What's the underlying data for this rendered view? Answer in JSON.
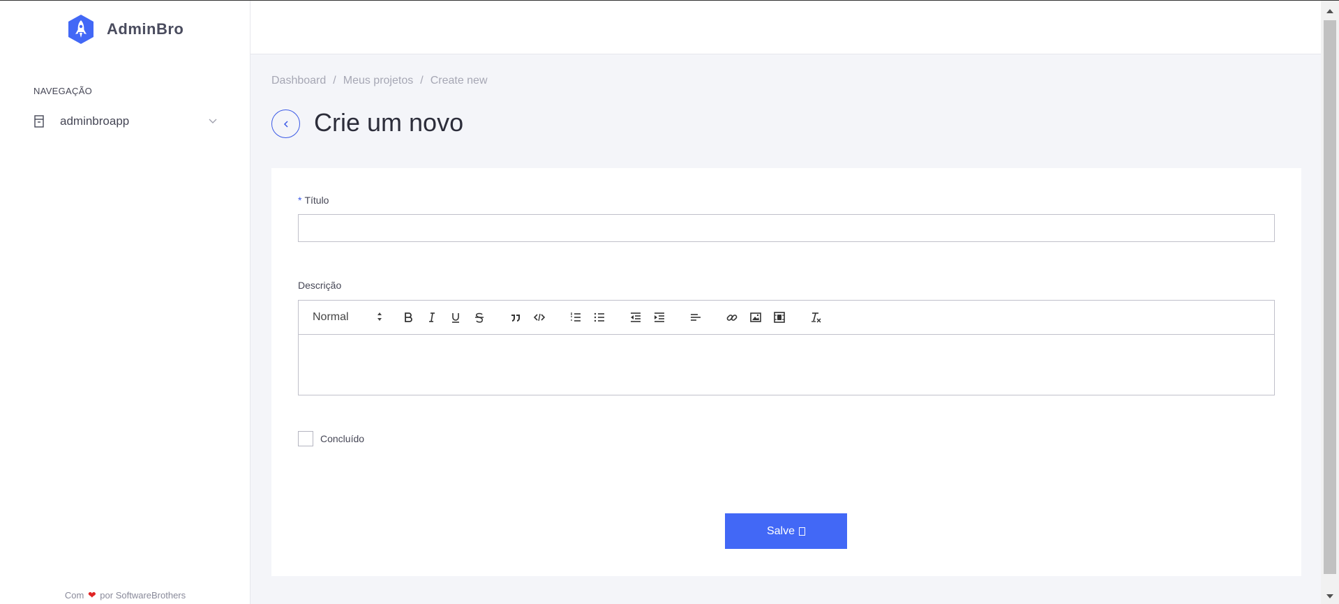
{
  "brand": {
    "name": "AdminBro",
    "accent": "#4268f6"
  },
  "sidebar": {
    "heading": "NAVEGAÇÃO",
    "items": [
      {
        "label": "adminbroapp",
        "icon": "database-icon"
      }
    ],
    "footer": {
      "prefix": "Com",
      "heart": "❤",
      "suffix": "por SoftwareBrothers"
    }
  },
  "breadcrumb": [
    "Dashboard",
    "Meus projetos",
    "Create new"
  ],
  "breadcrumb_separator": "/",
  "page": {
    "title": "Crie um novo"
  },
  "form": {
    "title_field": {
      "required_marker": "*",
      "label": "Título",
      "value": ""
    },
    "description_field": {
      "label": "Descrição",
      "format_select": "Normal",
      "toolbar": [
        [
          "bold-icon",
          "italic-icon",
          "underline-icon",
          "strikethrough-icon"
        ],
        [
          "blockquote-icon",
          "code-block-icon"
        ],
        [
          "ordered-list-icon",
          "bullet-list-icon"
        ],
        [
          "outdent-icon",
          "indent-icon"
        ],
        [
          "align-icon"
        ],
        [
          "link-icon",
          "image-icon",
          "video-icon"
        ],
        [
          "clear-format-icon"
        ]
      ]
    },
    "checkbox": {
      "label": "Concluído",
      "checked": false
    },
    "submit": {
      "label": "Salve"
    }
  }
}
